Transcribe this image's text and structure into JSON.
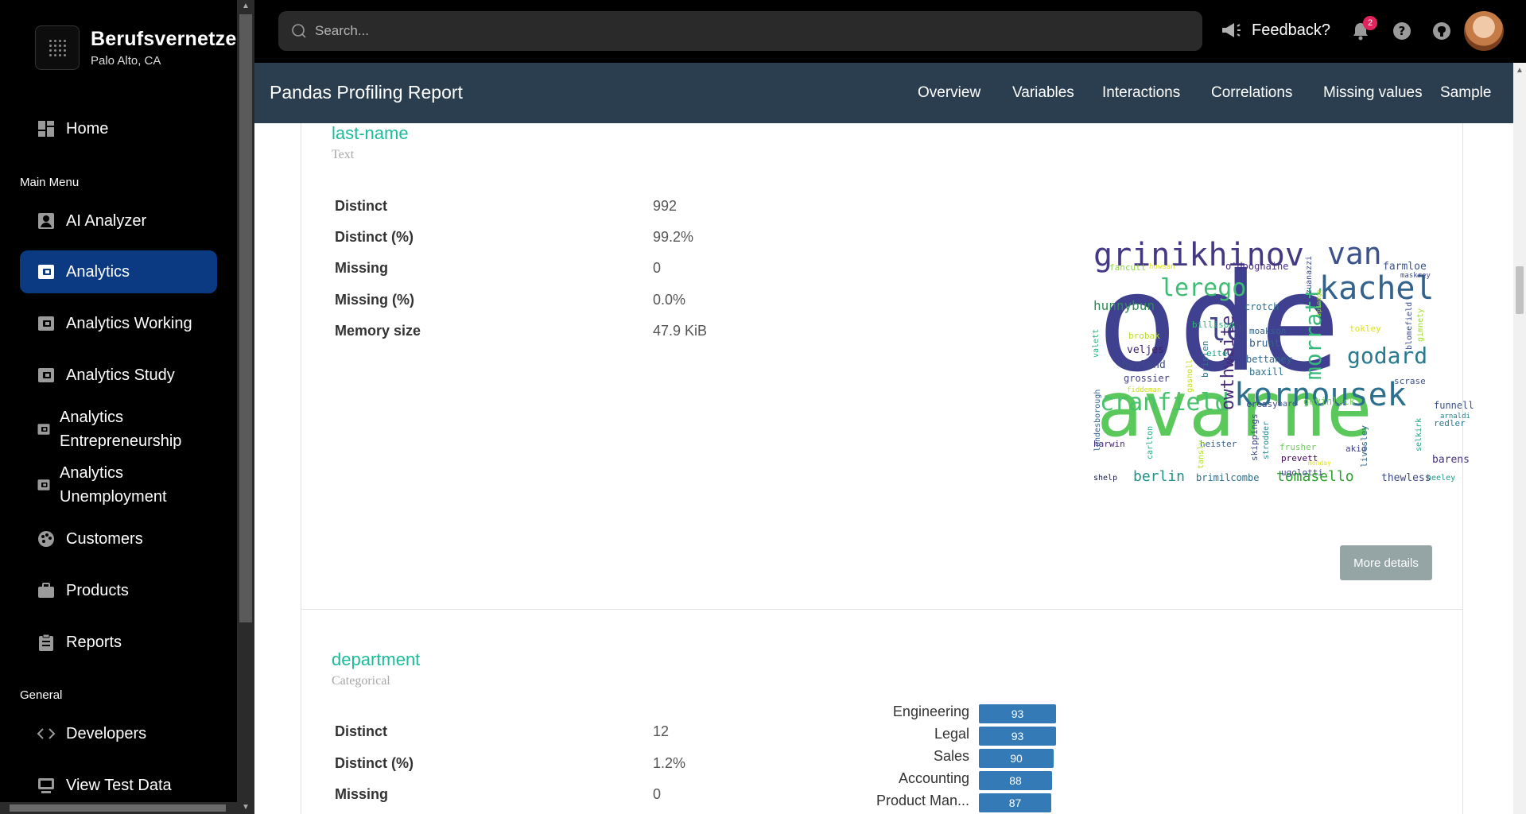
{
  "brand": {
    "name": "Berufsvernetzen",
    "location": "Palo Alto, CA"
  },
  "sidebar": {
    "home": "Home",
    "main_menu_label": "Main Menu",
    "items": [
      {
        "label": "AI Analyzer",
        "icon": "user-badge-icon"
      },
      {
        "label": "Analytics",
        "icon": "wallet-icon",
        "active": true
      },
      {
        "label": "Analytics Working",
        "icon": "wallet-icon"
      },
      {
        "label": "Analytics Study",
        "icon": "wallet-icon"
      },
      {
        "label": "Analytics Entrepreneurship",
        "icon": "wallet-icon"
      },
      {
        "label": "Analytics Unemployment",
        "icon": "wallet-icon"
      },
      {
        "label": "Customers",
        "icon": "palette-icon"
      },
      {
        "label": "Products",
        "icon": "briefcase-icon"
      },
      {
        "label": "Reports",
        "icon": "clipboard-icon"
      }
    ],
    "general_label": "General",
    "general_items": [
      {
        "label": "Developers",
        "icon": "code-icon"
      },
      {
        "label": "View Test Data",
        "icon": "monitor-icon"
      }
    ]
  },
  "topbar": {
    "search_placeholder": "Search...",
    "feedback_label": "Feedback?",
    "notification_count": "2"
  },
  "report": {
    "title": "Pandas Profiling Report",
    "nav": [
      "Overview",
      "Variables",
      "Interactions",
      "Correlations",
      "Missing values",
      "Sample"
    ]
  },
  "variables": [
    {
      "name": "last-name",
      "type": "Text",
      "stats": [
        {
          "k": "Distinct",
          "v": "992"
        },
        {
          "k": "Distinct (%)",
          "v": "99.2%"
        },
        {
          "k": "Missing",
          "v": "0"
        },
        {
          "k": "Missing (%)",
          "v": "0.0%"
        },
        {
          "k": "Memory size",
          "v": "47.9 KiB"
        }
      ],
      "more_details": "More details",
      "wordcloud": [
        {
          "w": "avarne"
        },
        {
          "w": "ode"
        },
        {
          "w": "grinikhinov"
        },
        {
          "w": "van"
        },
        {
          "w": "kachel"
        },
        {
          "w": "kornousek"
        },
        {
          "w": "cranfield"
        },
        {
          "w": "lerego"
        },
        {
          "w": "le"
        },
        {
          "w": "godard"
        },
        {
          "w": "morratt"
        },
        {
          "w": "owthwaite"
        },
        {
          "w": "tomasello"
        },
        {
          "w": "berlin"
        },
        {
          "w": "hunnybun"
        },
        {
          "w": "veljes"
        },
        {
          "w": "hayland"
        },
        {
          "w": "grossier"
        },
        {
          "w": "brunt"
        },
        {
          "w": "bettaney"
        },
        {
          "w": "baxill"
        },
        {
          "w": "moakson"
        },
        {
          "w": "funnell"
        },
        {
          "w": "barens"
        },
        {
          "w": "redler"
        },
        {
          "w": "brimilcombe"
        },
        {
          "w": "thewless"
        },
        {
          "w": "heeley"
        },
        {
          "w": "shelp"
        },
        {
          "w": "harwin"
        },
        {
          "w": "heister"
        },
        {
          "w": "prevett"
        },
        {
          "w": "frusher"
        },
        {
          "w": "ugolotti"
        },
        {
          "w": "akid"
        },
        {
          "w": "crotch"
        },
        {
          "w": "billison"
        },
        {
          "w": "brobak"
        },
        {
          "w": "fancutt"
        },
        {
          "w": "o'dooghaine"
        },
        {
          "w": "farmloe"
        },
        {
          "w": "tokley"
        },
        {
          "w": "scrase"
        },
        {
          "w": "govinlock"
        },
        {
          "w": "creasy"
        },
        {
          "w": "bare"
        },
        {
          "w": "brislen"
        },
        {
          "w": "eite"
        },
        {
          "w": "gasnoll"
        },
        {
          "w": "valett"
        },
        {
          "w": "londesborough"
        },
        {
          "w": "carlton"
        },
        {
          "w": "tansly"
        },
        {
          "w": "skippings"
        },
        {
          "w": "strodder"
        },
        {
          "w": "livesley"
        },
        {
          "w": "selkirk"
        },
        {
          "w": "blomefield"
        },
        {
          "w": "gimnety"
        },
        {
          "w": "zuanazzi"
        },
        {
          "w": "arnaldi"
        },
        {
          "w": "maskrey"
        },
        {
          "w": "howsan"
        },
        {
          "w": "fiddeman"
        },
        {
          "w": "spinage"
        },
        {
          "w": "monday"
        }
      ]
    },
    {
      "name": "department",
      "type": "Categorical",
      "stats": [
        {
          "k": "Distinct",
          "v": "12"
        },
        {
          "k": "Distinct (%)",
          "v": "1.2%"
        },
        {
          "k": "Missing",
          "v": "0"
        }
      ],
      "bars": [
        {
          "label": "Engineering",
          "value": 93
        },
        {
          "label": "Legal",
          "value": 93
        },
        {
          "label": "Sales",
          "value": 90
        },
        {
          "label": "Accounting",
          "value": 88
        },
        {
          "label": "Product Man...",
          "value": 87
        }
      ]
    }
  ],
  "colors": {
    "sidebar_bg": "#000000",
    "active_item": "#0b3a82",
    "report_header": "#2b3e50",
    "var_name": "#1abc9c",
    "bar": "#337ab7",
    "button": "#95a5a6"
  }
}
